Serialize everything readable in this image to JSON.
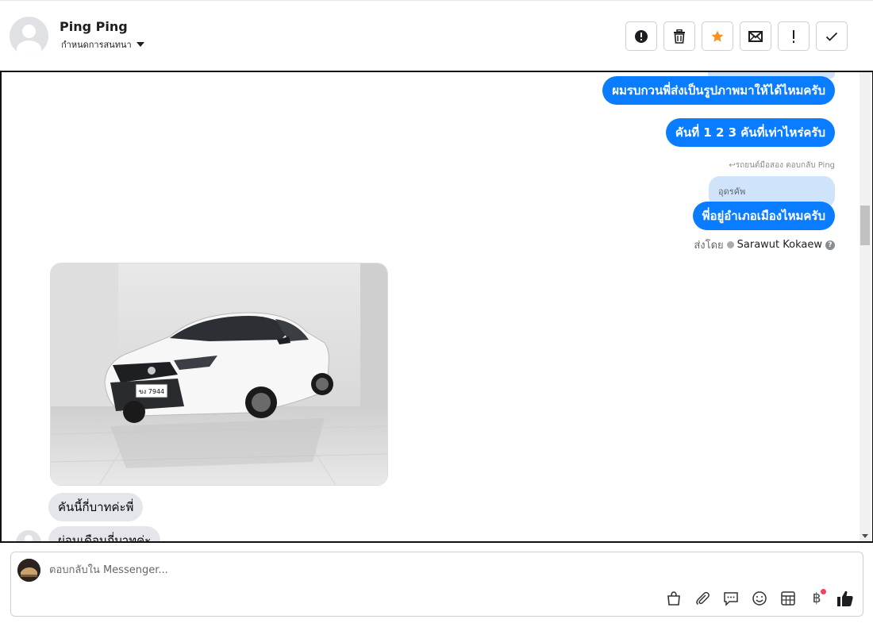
{
  "header": {
    "contact_name": "Ping Ping",
    "assign_label": "กำหนดการสนทนา",
    "actions": [
      {
        "icon": "alert-circle-icon",
        "name": "mark-spam-button"
      },
      {
        "icon": "trash-icon",
        "name": "delete-button"
      },
      {
        "icon": "star-icon",
        "name": "star-button",
        "color": "#f7931e"
      },
      {
        "icon": "envelope-icon",
        "name": "mark-unread-button"
      },
      {
        "icon": "exclamation-icon",
        "name": "follow-up-button"
      },
      {
        "icon": "check-icon",
        "name": "mark-done-button"
      }
    ]
  },
  "thread": {
    "messages_out": [
      {
        "text": "ผมรบกวนพี่ส่งเป็นรูปภาพมาให้ได้ไหมครับ"
      },
      {
        "text": "คันที่ 1 2 3 คันที่เท่าไหร่ครับ"
      },
      {
        "text": "พี่อยู่อำเภอเมืองไหมครับ"
      }
    ],
    "reply_meta": "↩รถยนต์มือสอง ตอบกลับ Ping",
    "reply_quote": "อุดรคัพ",
    "sent_by_label": "ส่งโดย",
    "sent_by_name": "Sarawut Kokaew",
    "messages_in": [
      {
        "text": "คันนี้กี่บาทค่ะพี่"
      },
      {
        "text": "ผ่อนเดือนกี่บาทค่ะ"
      }
    ],
    "photo_plate": "ขง 7944"
  },
  "composer": {
    "placeholder": "ตอบกลับใน Messenger...",
    "tools": [
      "shopping-bag-icon",
      "paperclip-icon",
      "saved-reply-icon",
      "emoji-icon",
      "calendar-icon",
      "payment-baht-icon",
      "like-icon"
    ],
    "accent_color": "#0a7cff"
  }
}
